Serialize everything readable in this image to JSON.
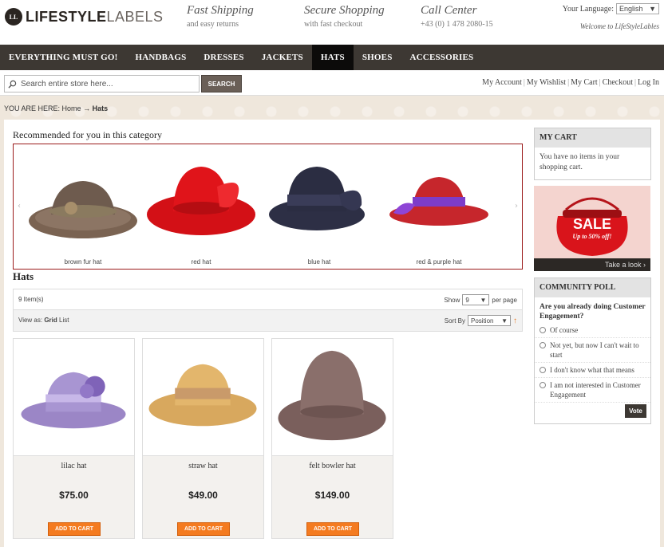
{
  "brand": {
    "logo_mark": "LL",
    "name_bold": "LIFESTYLE",
    "name_light": "LABELS"
  },
  "promos": [
    {
      "title": "Fast Shipping",
      "subtitle": "and easy returns"
    },
    {
      "title": "Secure Shopping",
      "subtitle": "with fast checkout"
    },
    {
      "title": "Call Center",
      "subtitle": "+43 (0) 1 478 2080-15"
    }
  ],
  "language": {
    "label": "Your Language:",
    "selected": "English",
    "welcome": "Welcome to LifeStyleLables"
  },
  "nav": {
    "items": [
      {
        "label": "EVERYTHING MUST GO!"
      },
      {
        "label": "HANDBAGS"
      },
      {
        "label": "DRESSES"
      },
      {
        "label": "JACKETS"
      },
      {
        "label": "HATS"
      },
      {
        "label": "SHOES"
      },
      {
        "label": "ACCESSORIES"
      }
    ],
    "active": "HATS"
  },
  "search": {
    "placeholder": "Search entire store here...",
    "button": "SEARCH"
  },
  "account_links": [
    "My Account",
    "My Wishlist",
    "My Cart",
    "Checkout",
    "Log In"
  ],
  "breadcrumb": {
    "prefix": "YOU ARE HERE:",
    "home": "Home",
    "arrow": "→",
    "current": "Hats"
  },
  "recommended": {
    "title": "Recommended for you in this category",
    "items": [
      {
        "label": "brown fur hat",
        "color": "#6e5b4e"
      },
      {
        "label": "red hat",
        "color": "#e0141a"
      },
      {
        "label": "blue hat",
        "color": "#2d2f45"
      },
      {
        "label": "red & purple hat",
        "color": "#c6262c"
      }
    ]
  },
  "category": {
    "title": "Hats"
  },
  "toolbar": {
    "count": "9 Item(s)",
    "show_label": "Show",
    "show_value": "9",
    "per_page": "per page",
    "view_as": "View as:",
    "grid": "Grid",
    "list": "List",
    "sort_by": "Sort By",
    "sort_value": "Position"
  },
  "products": [
    {
      "name": "lilac hat",
      "price": "$75.00",
      "button": "ADD TO CART"
    },
    {
      "name": "straw hat",
      "price": "$49.00",
      "button": "ADD TO CART"
    },
    {
      "name": "felt bowler hat",
      "price": "$149.00",
      "button": "ADD TO CART"
    }
  ],
  "cart": {
    "title": "MY CART",
    "message": "You have no items in your shopping cart."
  },
  "sale_banner": {
    "title": "SALE",
    "subtitle": "Up to 50% off!",
    "link": "Take a look ›"
  },
  "poll": {
    "title": "COMMUNITY POLL",
    "question": "Are you already doing Customer Engagement?",
    "options": [
      "Of course",
      "Not yet, but now I can't wait to start",
      "I don't know what that means",
      "I am not interested in Customer Engagement"
    ],
    "button": "Vote"
  },
  "colors": {
    "nav_bg": "#3d3833",
    "nav_active": "#0c0b0a",
    "cart_button": "#f47b20",
    "carousel_border": "#9b1b1b"
  }
}
